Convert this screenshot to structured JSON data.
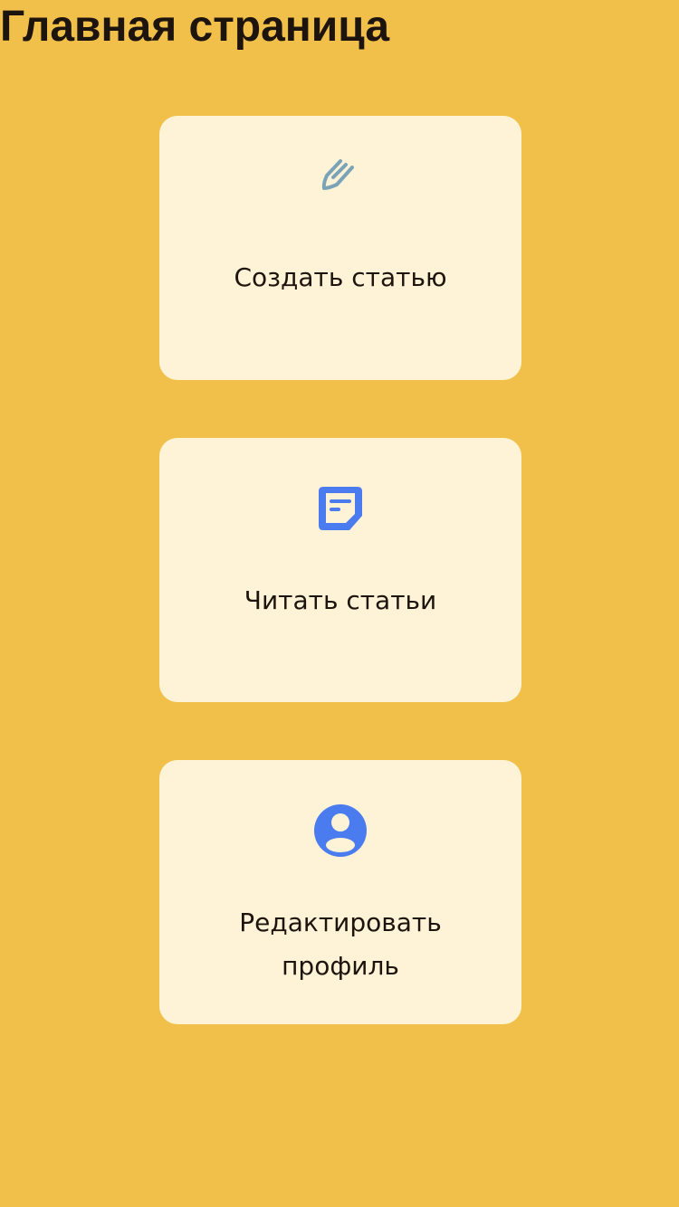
{
  "header": {
    "title": "Главная страница"
  },
  "cards": [
    {
      "label": "Создать статью",
      "icon": "pen-icon",
      "icon_color": "#7BA3B8"
    },
    {
      "label": "Читать статьи",
      "icon": "note-icon",
      "icon_color": "#4A7BEF"
    },
    {
      "label": "Редактировать профиль",
      "icon": "profile-icon",
      "icon_color": "#4A7BEF"
    }
  ],
  "colors": {
    "background": "#F0C04A",
    "card": "#FEF3D6",
    "text": "#1E140E"
  }
}
